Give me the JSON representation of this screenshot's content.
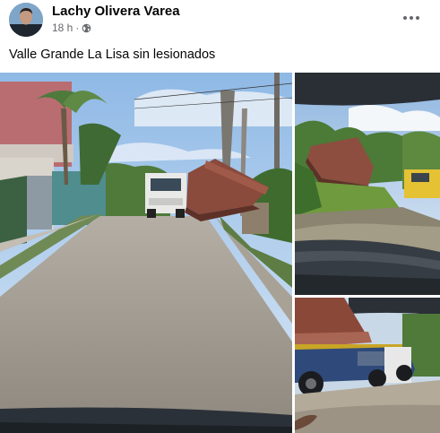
{
  "post": {
    "author_name": "Lachy Olivera Varea",
    "timestamp": "18 h",
    "timestamp_separator": "·",
    "privacy_icon": "globe-icon",
    "more_icon": "more-horizontal-icon",
    "caption": "Valle Grande La Lisa sin lesionados"
  },
  "photos": [
    {
      "name": "photo-main-street-truck",
      "subject": "street-truck-container"
    },
    {
      "name": "photo-container-in-water",
      "subject": "container-water"
    },
    {
      "name": "photo-tow-truck-closeup",
      "subject": "tow-truck"
    }
  ],
  "colors": {
    "author_text": "#050505",
    "meta_text": "#65676b",
    "container_rust": "#8a4a3c",
    "sky": "#a9c9ea"
  }
}
